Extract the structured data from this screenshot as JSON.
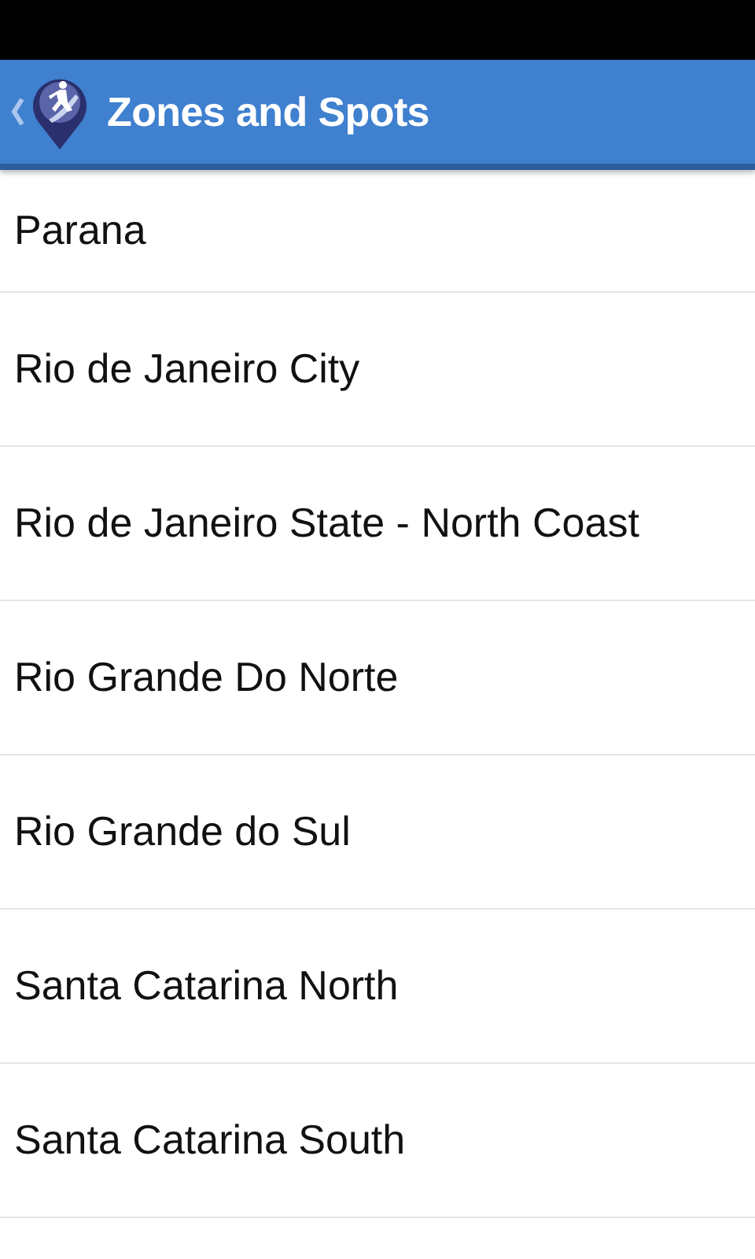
{
  "action_bar": {
    "title": "Zones and Spots"
  },
  "zones": [
    {
      "name": "Parana"
    },
    {
      "name": "Rio de Janeiro City"
    },
    {
      "name": "Rio de Janeiro State - North Coast"
    },
    {
      "name": "Rio Grande Do Norte"
    },
    {
      "name": "Rio Grande do Sul"
    },
    {
      "name": "Santa Catarina North"
    },
    {
      "name": "Santa Catarina South"
    }
  ]
}
